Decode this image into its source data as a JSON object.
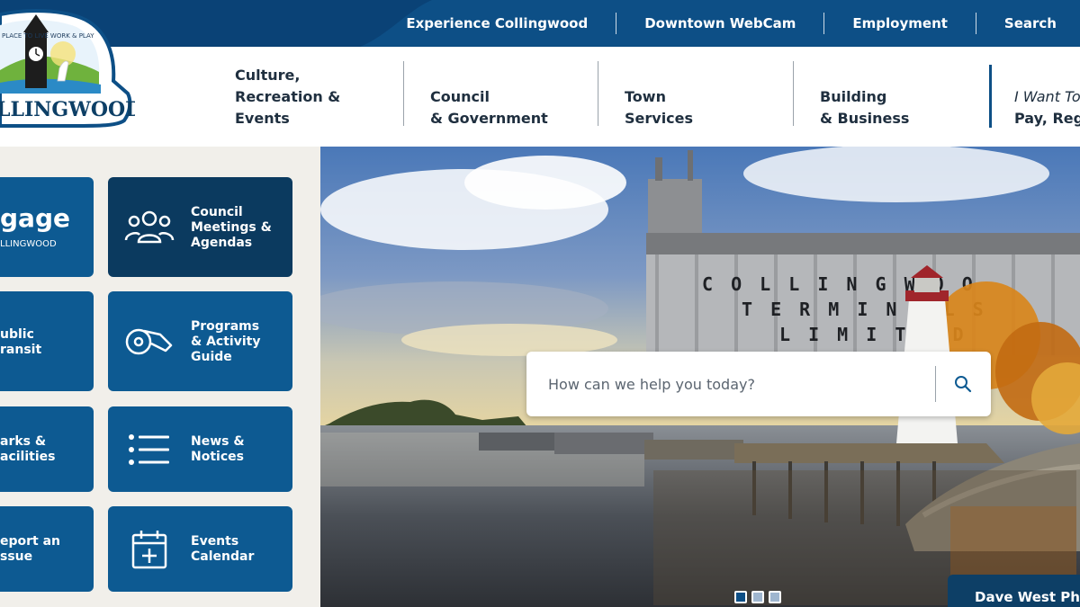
{
  "utility_nav": [
    {
      "label": "Experience Collingwood"
    },
    {
      "label": "Downtown WebCam"
    },
    {
      "label": "Employment"
    },
    {
      "label": "Search"
    }
  ],
  "logo": {
    "tagline": "PLACE TO LIVE WORK & PLAY",
    "name": "LLINGWOOD"
  },
  "main_nav": [
    {
      "line1": "Culture,",
      "line2": "Recreation &",
      "line3": "Events"
    },
    {
      "line1": "Council",
      "line2": "& Government"
    },
    {
      "line1": "Town",
      "line2": "Services"
    },
    {
      "line1": "Building",
      "line2": "& Business"
    },
    {
      "line1": "I Want To",
      "line2": "Pay, Regi"
    }
  ],
  "tiles": [
    {
      "title": "gage",
      "subtitle": "LLINGWOOD"
    },
    {
      "line1": "Council",
      "line2": "Meetings &",
      "line3": "Agendas",
      "icon": "people-icon"
    },
    {
      "line1": "ublic",
      "line2": "ransit"
    },
    {
      "line1": "Programs",
      "line2": "& Activity",
      "line3": "Guide",
      "icon": "whistle-icon"
    },
    {
      "line1": "arks &",
      "line2": "acilities"
    },
    {
      "line1": "News &",
      "line2": "Notices",
      "icon": "list-icon"
    },
    {
      "line1": "eport an",
      "line2": "ssue"
    },
    {
      "line1": "Events",
      "line2": "Calendar",
      "icon": "calendar-add-icon"
    }
  ],
  "hero": {
    "silo_text_row1": "C O L L I N G W O O",
    "silo_text_row2": "T E R M I N A L S",
    "silo_text_row3": "L I M I T E D",
    "credit": "Dave West Pho"
  },
  "search": {
    "placeholder": "How can we help you today?",
    "icon": "search-icon"
  },
  "slider_dots": 3,
  "colors": {
    "brand_blue": "#0d4f86",
    "tile_blue": "#0d5a92",
    "tile_dark": "#0b3a5f"
  }
}
